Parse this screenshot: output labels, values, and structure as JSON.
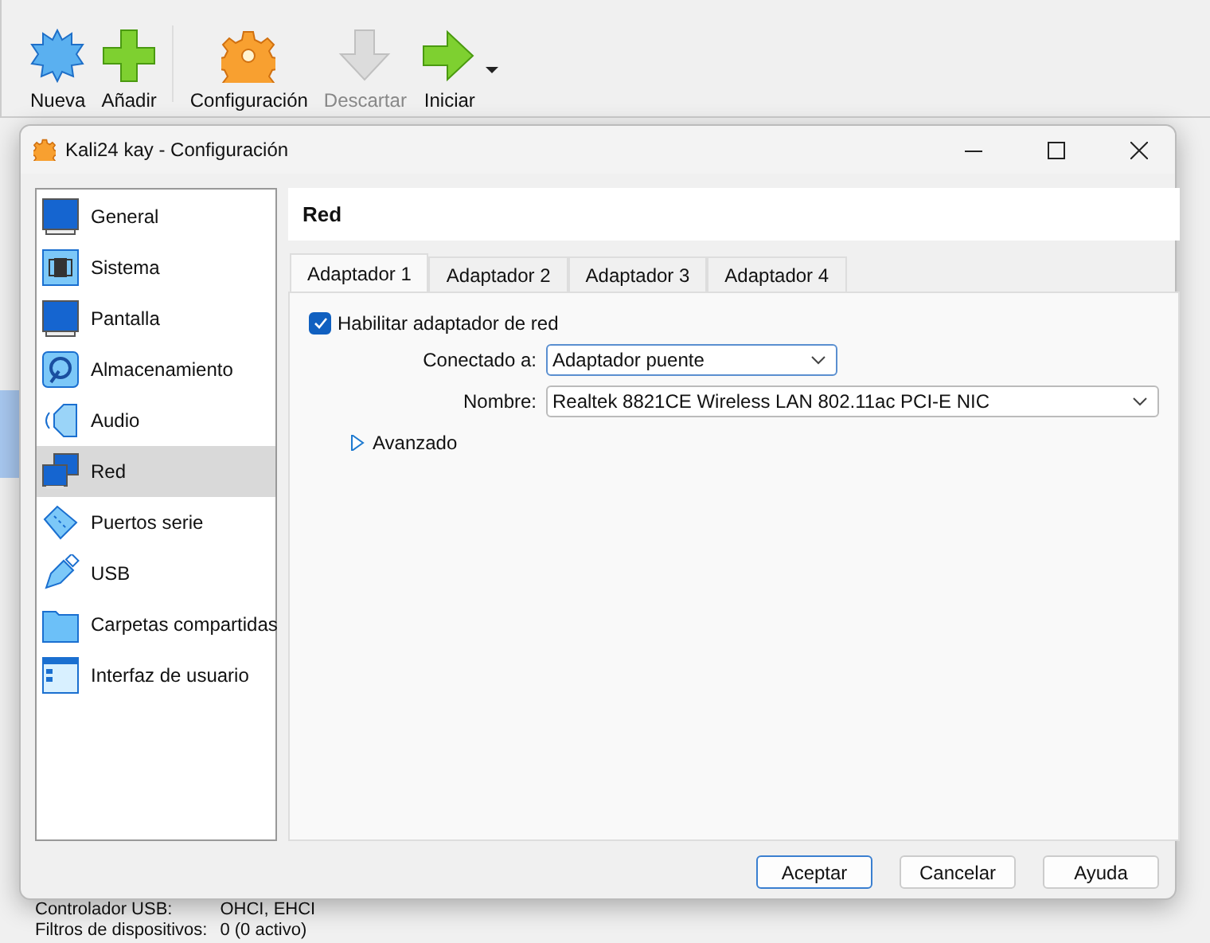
{
  "toolbar": [
    {
      "label": "Nueva",
      "disabled": false
    },
    {
      "label": "Añadir",
      "disabled": false
    },
    {
      "label": "Configuración",
      "disabled": false
    },
    {
      "label": "Descartar",
      "disabled": true
    },
    {
      "label": "Iniciar",
      "disabled": false
    }
  ],
  "details": [
    {
      "label": "Controlador USB:",
      "value": "OHCI, EHCI"
    },
    {
      "label": "Filtros de dispositivos:",
      "value": "0 (0 activo)"
    }
  ],
  "dialog": {
    "title": "Kali24 kay - Configuración",
    "sidebar": [
      {
        "label": "General",
        "selected": false
      },
      {
        "label": "Sistema",
        "selected": false
      },
      {
        "label": "Pantalla",
        "selected": false
      },
      {
        "label": "Almacenamiento",
        "selected": false
      },
      {
        "label": "Audio",
        "selected": false
      },
      {
        "label": "Red",
        "selected": true
      },
      {
        "label": "Puertos serie",
        "selected": false
      },
      {
        "label": "USB",
        "selected": false
      },
      {
        "label": "Carpetas compartidas",
        "selected": false
      },
      {
        "label": "Interfaz de usuario",
        "selected": false
      }
    ],
    "heading": "Red",
    "tabs": [
      {
        "label": "Adaptador 1",
        "selected": true
      },
      {
        "label": "Adaptador 2",
        "selected": false
      },
      {
        "label": "Adaptador 3",
        "selected": false
      },
      {
        "label": "Adaptador 4",
        "selected": false
      }
    ],
    "enable": {
      "label": "Habilitar adaptador de red",
      "checked": true
    },
    "attached": {
      "label": "Conectado a:",
      "value": "Adaptador puente"
    },
    "name": {
      "label": "Nombre:",
      "value": "Realtek 8821CE Wireless LAN 802.11ac PCI-E NIC"
    },
    "advanced": {
      "label": "Avanzado",
      "expanded": false
    },
    "buttons": [
      "Aceptar",
      "Cancelar",
      "Ayuda"
    ]
  }
}
